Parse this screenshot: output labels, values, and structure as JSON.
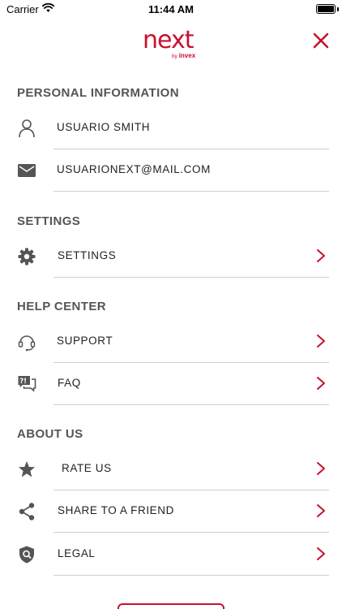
{
  "status_bar": {
    "carrier": "Carrier",
    "time": "11:44 AM"
  },
  "header": {
    "logo_text": "next",
    "logo_by": "by",
    "logo_brand": "invex",
    "accent_color": "#c8102e"
  },
  "sections": {
    "personal": {
      "title": "PERSONAL INFORMATION",
      "name": "USUARIO SMITH",
      "email": "USUARIONEXT@MAIL.COM"
    },
    "settings": {
      "title": "SETTINGS",
      "settings_label": "SETTINGS"
    },
    "help": {
      "title": "HELP CENTER",
      "support_label": "SUPPORT",
      "faq_label": "FAQ"
    },
    "about": {
      "title": "ABOUT US",
      "rate_label": "RATE US",
      "share_label": "SHARE TO A FRIEND",
      "legal_label": "LEGAL"
    }
  }
}
